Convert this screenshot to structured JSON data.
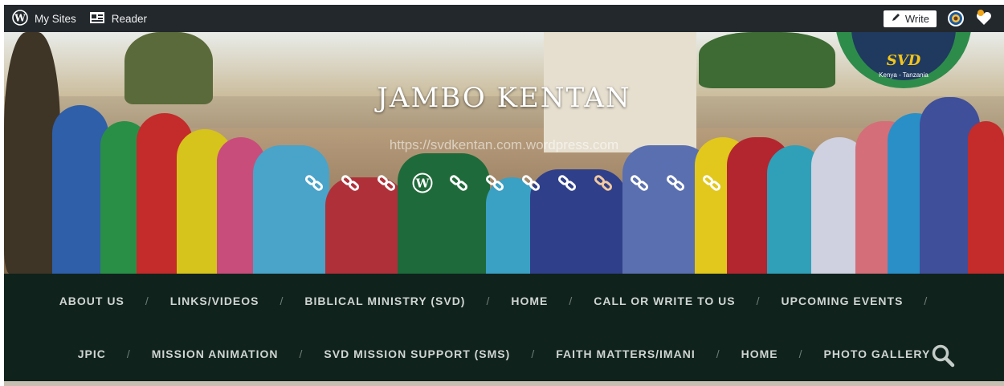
{
  "admin_bar": {
    "my_sites_label": "My Sites",
    "reader_label": "Reader",
    "write_label": "Write"
  },
  "header": {
    "site_title": "JAMBO KENTAN",
    "site_url": "https://svdkentan.com.wordpress.com",
    "logo_text": "SVD",
    "logo_subtext": "Kenya - Tanzania",
    "social_icons": [
      "link-icon",
      "link-icon",
      "link-icon",
      "wordpress-icon",
      "link-icon",
      "link-icon",
      "link-icon",
      "link-icon",
      "link-icon",
      "link-icon",
      "link-icon",
      "link-icon"
    ]
  },
  "nav": {
    "row1": [
      "ABOUT US",
      "LINKS/VIDEOS",
      "BIBLICAL MINISTRY (SVD)",
      "HOME",
      "CALL OR WRITE TO US",
      "UPCOMING EVENTS"
    ],
    "row2": [
      "JPIC",
      "MISSION ANIMATION",
      "SVD MISSION SUPPORT (SMS)",
      "FAITH MATTERS/IMANI",
      "HOME",
      "PHOTO GALLERY"
    ],
    "separator": "/"
  },
  "colors": {
    "admin_bar": "#23282d",
    "nav_background": "#10221c",
    "nav_text": "#cfd5d2"
  }
}
